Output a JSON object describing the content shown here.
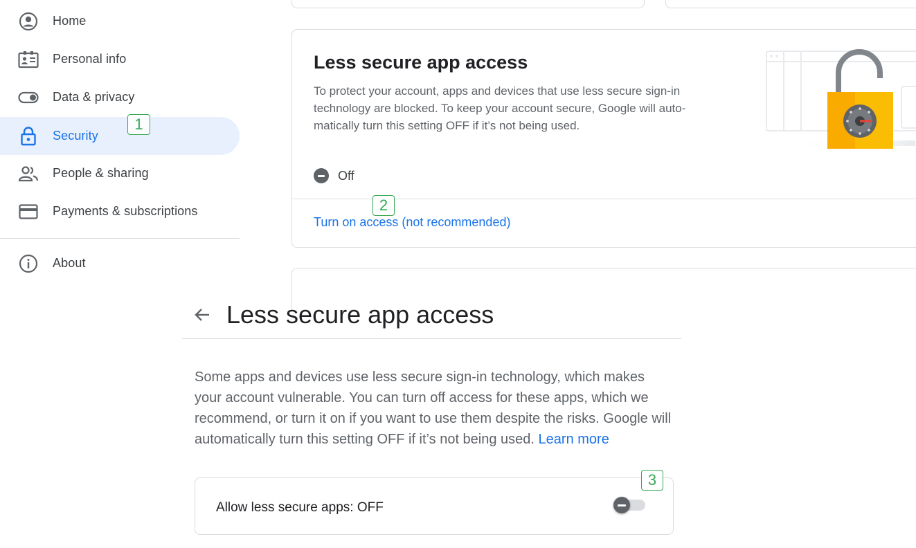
{
  "sidebar": {
    "items": [
      {
        "label": "Home",
        "icon": "account-circle-icon"
      },
      {
        "label": "Personal info",
        "icon": "id-card-icon"
      },
      {
        "label": "Data & privacy",
        "icon": "toggle-icon"
      },
      {
        "label": "Security",
        "icon": "lock-icon",
        "active": true
      },
      {
        "label": "People & sharing",
        "icon": "people-icon"
      },
      {
        "label": "Payments & subscriptions",
        "icon": "credit-card-icon"
      },
      {
        "label": "About",
        "icon": "info-icon"
      }
    ]
  },
  "badges": [
    "1",
    "2",
    "3"
  ],
  "card": {
    "title": "Less secure app access",
    "description": "To protect your account, apps and devices that use less secure sign-in technology are blocked. To keep your account secure, Google will auto-matically turn this setting OFF if it’s not being used.",
    "status": "Off",
    "link": "Turn on access (not recommended)",
    "illustration": "unlocked-padlock-illustration"
  },
  "lower": {
    "title": "Less secure app access",
    "description": "Some apps and devices use less secure sign-in technology, which makes your account vulnerable. You can turn off access for these apps, which we recommend, or turn it on if you want to use them despite the risks. Google will automatically turn this setting OFF if it’s not being used.",
    "learn_more": "Learn more",
    "toggle_label": "Allow less secure apps: OFF",
    "toggle_on": false
  },
  "colors": {
    "accent": "#1a73e8",
    "active_bg": "#e8f0fe",
    "badge": "#34a853",
    "lock_yellow": "#fbbc04"
  }
}
